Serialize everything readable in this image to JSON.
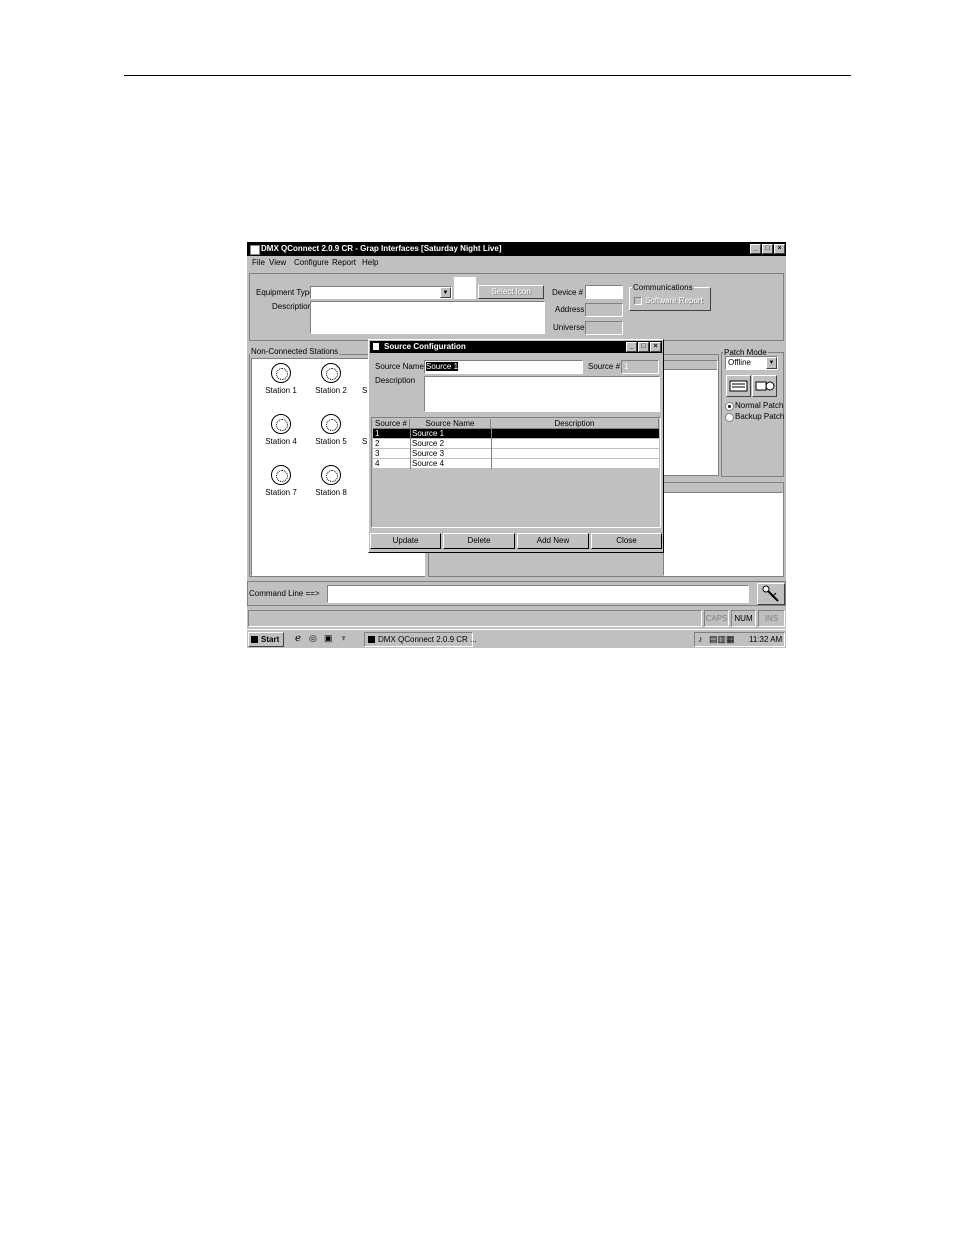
{
  "app": {
    "title": "DMX QConnect 2.0.9 CR - Grap Interfaces [Saturday Night Live]",
    "window_buttons": [
      "_",
      "□",
      "×"
    ]
  },
  "menu": [
    "File",
    "View",
    "Configure",
    "Report",
    "Help"
  ],
  "top_panel": {
    "equipment_type_label": "Equipment Type",
    "equipment_type_value": "",
    "description_label": "Description",
    "description_value": "",
    "select_icon_label": "Select Icon",
    "device_label": "Device #",
    "device_value": "",
    "address_label": "Address",
    "address_value": "",
    "universe_label": "Universe",
    "universe_value": "",
    "communications_label": "Communications",
    "enable_report_label": "Software Report"
  },
  "non_connected": {
    "label": "Non-Connected Stations",
    "stations": [
      "Station 1",
      "Station 2",
      "S",
      "Station 4",
      "Station 5",
      "S",
      "Station 7",
      "Station 8"
    ]
  },
  "patch_mode": {
    "label": "Patch Mode",
    "selected": "Offline",
    "normal_patch": "Normal Patch",
    "backup_patch": "Backup Patch"
  },
  "dialog": {
    "title": "Source Configuration",
    "source_name_label": "Source Name",
    "source_name_value": "Source 1",
    "source_num_label": "Source #",
    "source_num_value": "1",
    "description_label": "Description",
    "description_value": "",
    "columns": [
      "Source #",
      "Source Name",
      "Description"
    ],
    "rows": [
      {
        "num": "1",
        "name": "Source 1",
        "desc": ""
      },
      {
        "num": "2",
        "name": "Source 2",
        "desc": ""
      },
      {
        "num": "3",
        "name": "Source 3",
        "desc": ""
      },
      {
        "num": "4",
        "name": "Source 4",
        "desc": ""
      }
    ],
    "buttons": [
      "Update",
      "Delete",
      "Add New",
      "Close"
    ]
  },
  "command_line": {
    "label": "Command Line ==>",
    "value": ""
  },
  "status": {
    "caps": "CAPS",
    "num": "NUM",
    "ins": "INS"
  },
  "taskbar": {
    "start": "Start",
    "task": "DMX QConnect 2.0.9 CR ...",
    "clock": "11:32 AM"
  }
}
